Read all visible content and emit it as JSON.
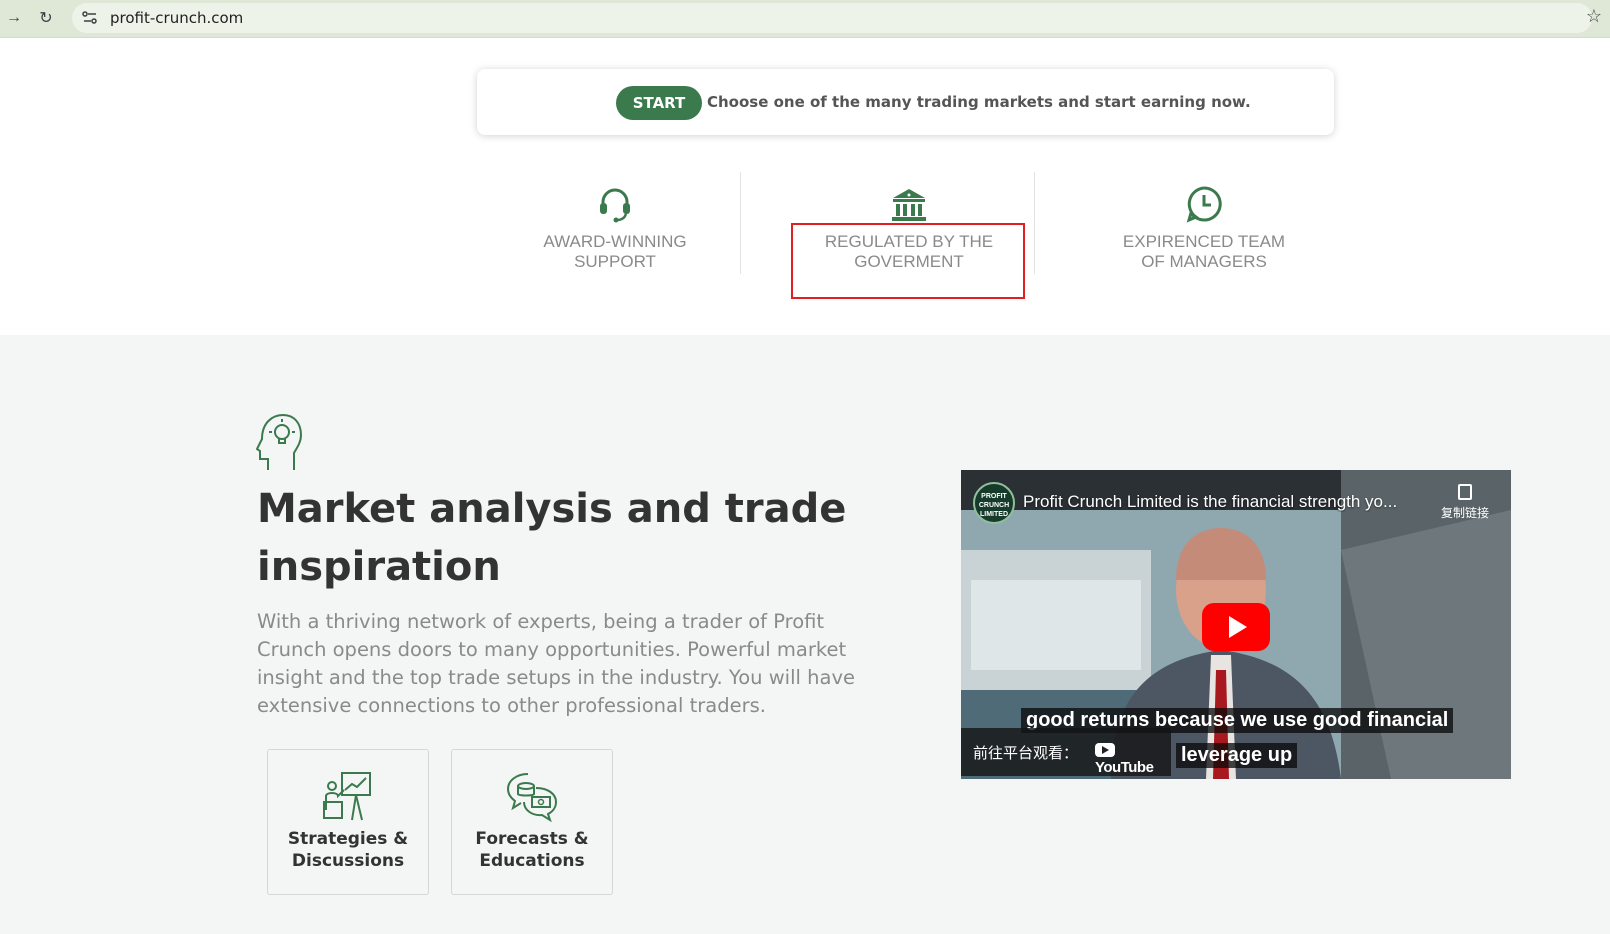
{
  "browser": {
    "url": "profit-crunch.com"
  },
  "banner": {
    "start_label": "START",
    "text": "Choose one of the many trading markets and start earning now."
  },
  "features": [
    {
      "label": "AWARD-WINNING SUPPORT",
      "icon": "headset-icon"
    },
    {
      "label": "REGULATED BY THE GOVERMENT",
      "icon": "bank-icon"
    },
    {
      "label": "EXPIRENCED TEAM OF MANAGERS",
      "icon": "clock-icon"
    }
  ],
  "section": {
    "title": "Market analysis and trade inspiration",
    "description": "With a thriving network of experts, being a trader of Profit Crunch opens doors to many opportunities. Powerful market insight and the top trade setups in the industry. You will have extensive connections to other professional traders.",
    "cards": [
      {
        "label": "Strategies & Discussions",
        "icon": "presentation-chart-icon"
      },
      {
        "label": "Forecasts & Educations",
        "icon": "money-chat-icon"
      }
    ]
  },
  "video": {
    "title": "Profit Crunch Limited is the financial strength yo...",
    "channel_logo_text": "PROFIT CRUNCH LIMITED",
    "copy_label": "复制链接",
    "caption_line1": "good returns because we use good financial",
    "caption_line2": "leverage up",
    "watch_on": "前往平台观看：",
    "youtube_label": "YouTube"
  },
  "colors": {
    "accent": "#3b7a4d",
    "highlight_border": "#e02020",
    "youtube_red": "#ff0000"
  }
}
